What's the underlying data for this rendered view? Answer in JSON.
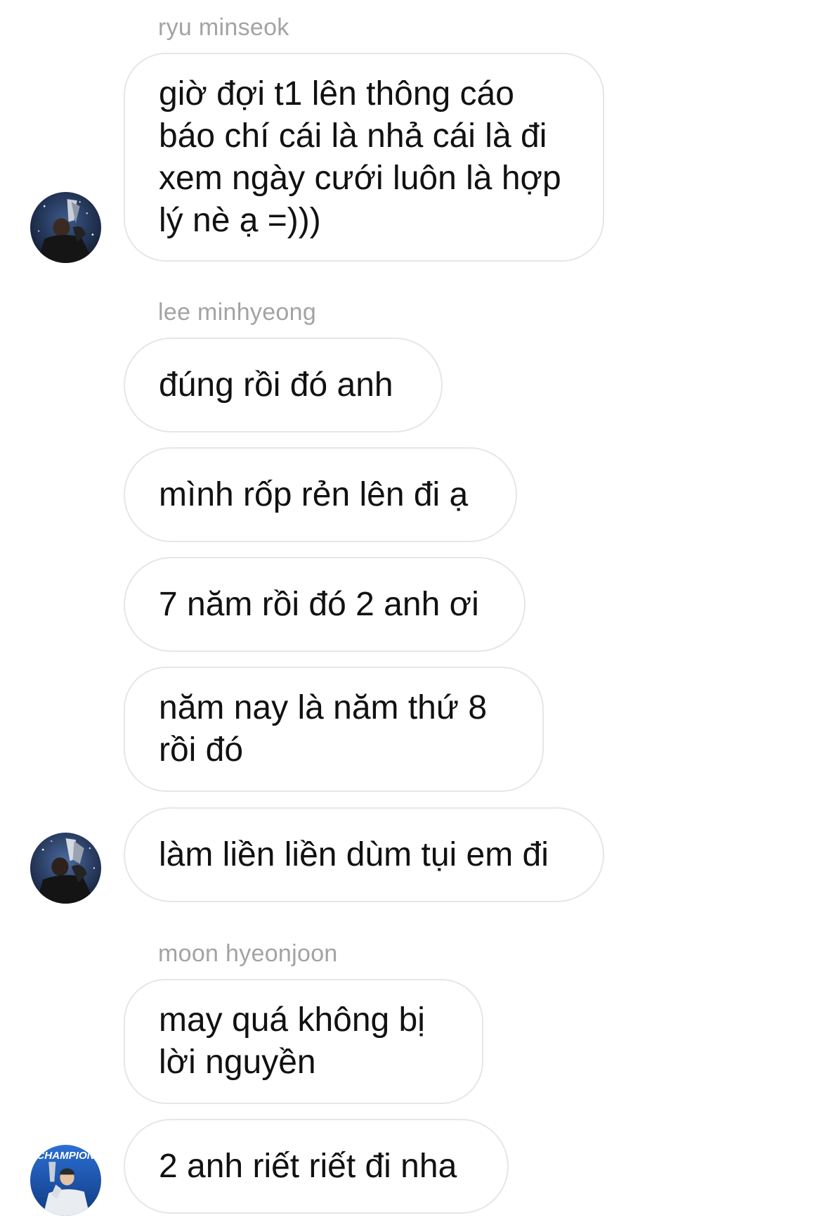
{
  "conversation": {
    "groups": [
      {
        "sender": "ryu minseok",
        "messages": [
          "giờ đợi t1 lên thông cáo báo chí cái là nhả cái là đi xem ngày cưới luôn là hợp lý nè ạ =)))"
        ]
      },
      {
        "sender": "lee minhyeong",
        "messages": [
          "đúng rồi đó anh",
          "mình rốp rẻn lên đi ạ",
          "7 năm rồi đó 2 anh ơi",
          "năm nay là năm thứ 8 rồi đó",
          "làm liền liền dùm tụi em đi"
        ]
      },
      {
        "sender": "moon hyeonjoon",
        "messages": [
          "may quá không bị lời nguyền",
          "2 anh riết riết đi nha"
        ]
      }
    ],
    "avatars": [
      {
        "icon": "trophy-photo-avatar-icon"
      },
      {
        "icon": "trophy-photo-avatar-icon"
      },
      {
        "icon": "champion-photo-avatar-icon",
        "text": "CHAMPION"
      }
    ],
    "colors": {
      "bubble_border": "#e6e6e6",
      "sender_name": "#a3a3a3",
      "message_text": "#111111",
      "background": "#ffffff"
    }
  }
}
